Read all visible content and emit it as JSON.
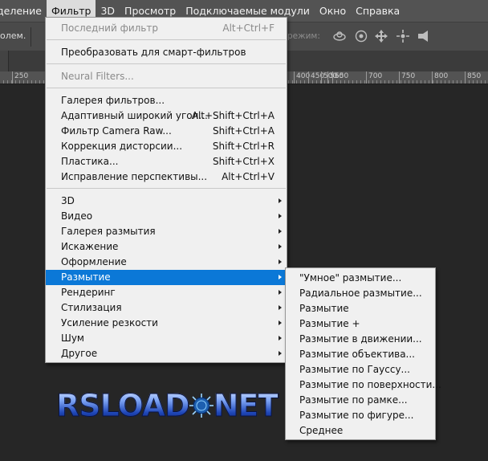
{
  "menubar": {
    "items": [
      {
        "label": "деление",
        "active": false
      },
      {
        "label": "Фильтр",
        "active": true
      },
      {
        "label": "3D",
        "active": false
      },
      {
        "label": "Просмотр",
        "active": false
      },
      {
        "label": "Подключаемые модули",
        "active": false
      },
      {
        "label": "Окно",
        "active": false
      },
      {
        "label": "Справка",
        "active": false
      }
    ]
  },
  "options_bar": {
    "left_label": "олем.",
    "mode_label": "режим:",
    "icons": [
      "orbit-icon",
      "roll-icon",
      "pan-icon",
      "slide-icon",
      "scale-icon"
    ]
  },
  "ruler": {
    "labels": [
      "250",
      "400",
      "450",
      "500",
      "550",
      "600",
      "650",
      "700",
      "750",
      "800",
      "850"
    ]
  },
  "filter_menu": {
    "items": [
      {
        "label": "Последний фильтр",
        "shortcut": "Alt+Ctrl+F",
        "disabled": true
      },
      {
        "label": "Преобразовать для смарт-фильтров",
        "shortcut": ""
      },
      {
        "label": "Neural Filters...",
        "shortcut": "",
        "disabled": true
      },
      {
        "label": "Галерея фильтров...",
        "shortcut": ""
      },
      {
        "label": "Адаптивный широкий угол...",
        "shortcut": "Alt+Shift+Ctrl+A"
      },
      {
        "label": "Фильтр Camera Raw...",
        "shortcut": "Shift+Ctrl+A"
      },
      {
        "label": "Коррекция дисторсии...",
        "shortcut": "Shift+Ctrl+R"
      },
      {
        "label": "Пластика...",
        "shortcut": "Shift+Ctrl+X"
      },
      {
        "label": "Исправление перспективы...",
        "shortcut": "Alt+Ctrl+V"
      },
      {
        "label": "3D",
        "submenu": true
      },
      {
        "label": "Видео",
        "submenu": true
      },
      {
        "label": "Галерея размытия",
        "submenu": true
      },
      {
        "label": "Искажение",
        "submenu": true
      },
      {
        "label": "Оформление",
        "submenu": true
      },
      {
        "label": "Размытие",
        "submenu": true,
        "selected": true
      },
      {
        "label": "Рендеринг",
        "submenu": true
      },
      {
        "label": "Стилизация",
        "submenu": true
      },
      {
        "label": "Усиление резкости",
        "submenu": true
      },
      {
        "label": "Шум",
        "submenu": true
      },
      {
        "label": "Другое",
        "submenu": true
      }
    ]
  },
  "blur_submenu": {
    "items": [
      "\"Умное\" размытие...",
      "Радиальное размытие...",
      "Размытие",
      "Размытие +",
      "Размытие в движении...",
      "Размытие объектива...",
      "Размытие по Гауссу...",
      "Размытие по поверхности...",
      "Размытие по рамке...",
      "Размытие по фигуре...",
      "Среднее"
    ]
  },
  "watermark": {
    "left": "RSLOAD",
    "right": "NET"
  },
  "colors": {
    "menubar_bg": "#535353",
    "menu_bg": "#f0f0f0",
    "highlight": "#0b78d7",
    "canvas_bg": "#262626"
  }
}
